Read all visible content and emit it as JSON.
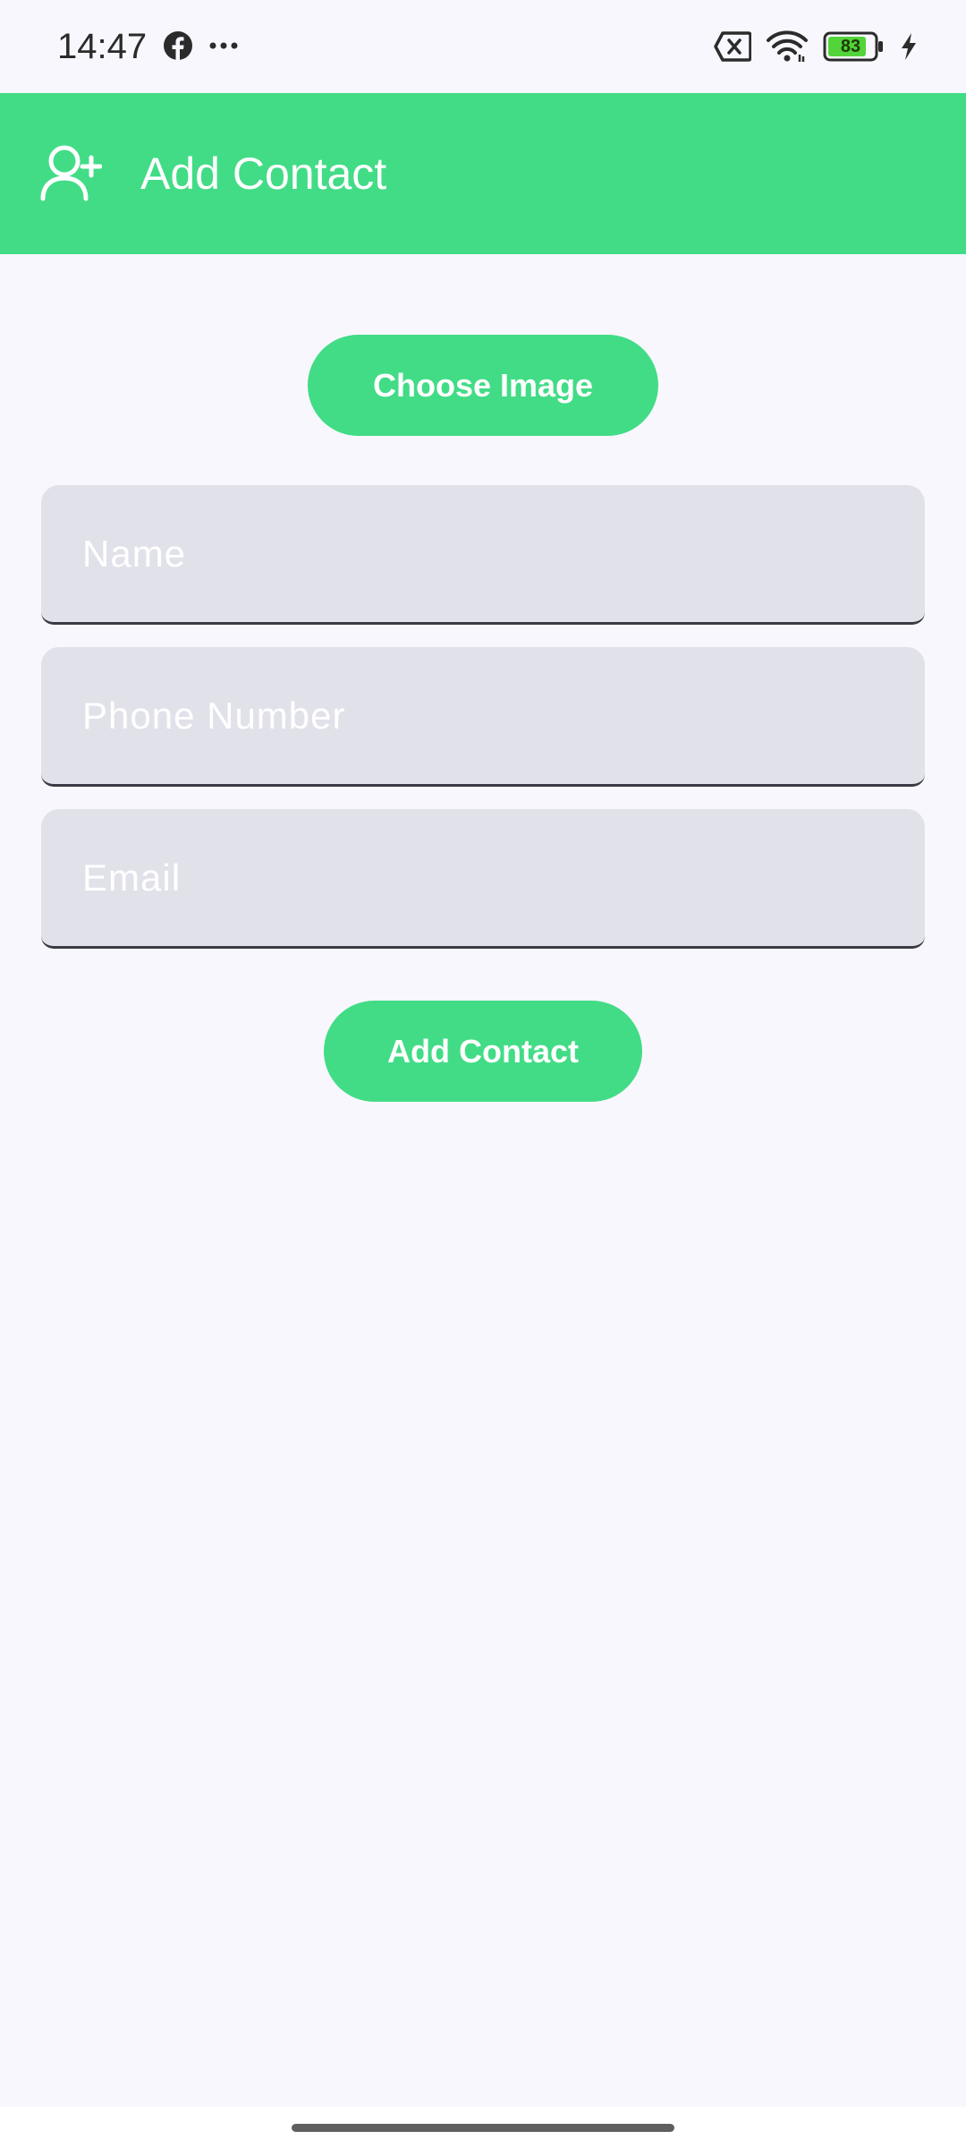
{
  "status_bar": {
    "time": "14:47",
    "battery_level": "83",
    "icons": [
      "facebook-icon",
      "more-dots-icon",
      "no-sim-icon",
      "wifi-icon",
      "battery-icon",
      "charging-icon"
    ]
  },
  "app_bar": {
    "title": "Add Contact",
    "icon": "add-person-icon",
    "background_color": "#42dc86"
  },
  "form": {
    "choose_image_label": "Choose Image",
    "fields": {
      "name": {
        "placeholder": "Name",
        "value": ""
      },
      "phone": {
        "placeholder": "Phone Number",
        "value": ""
      },
      "email": {
        "placeholder": "Email",
        "value": ""
      }
    },
    "submit_label": "Add Contact"
  },
  "colors": {
    "accent": "#42dc86",
    "background": "#f7f7fd",
    "field_background": "#e1e1ea"
  }
}
